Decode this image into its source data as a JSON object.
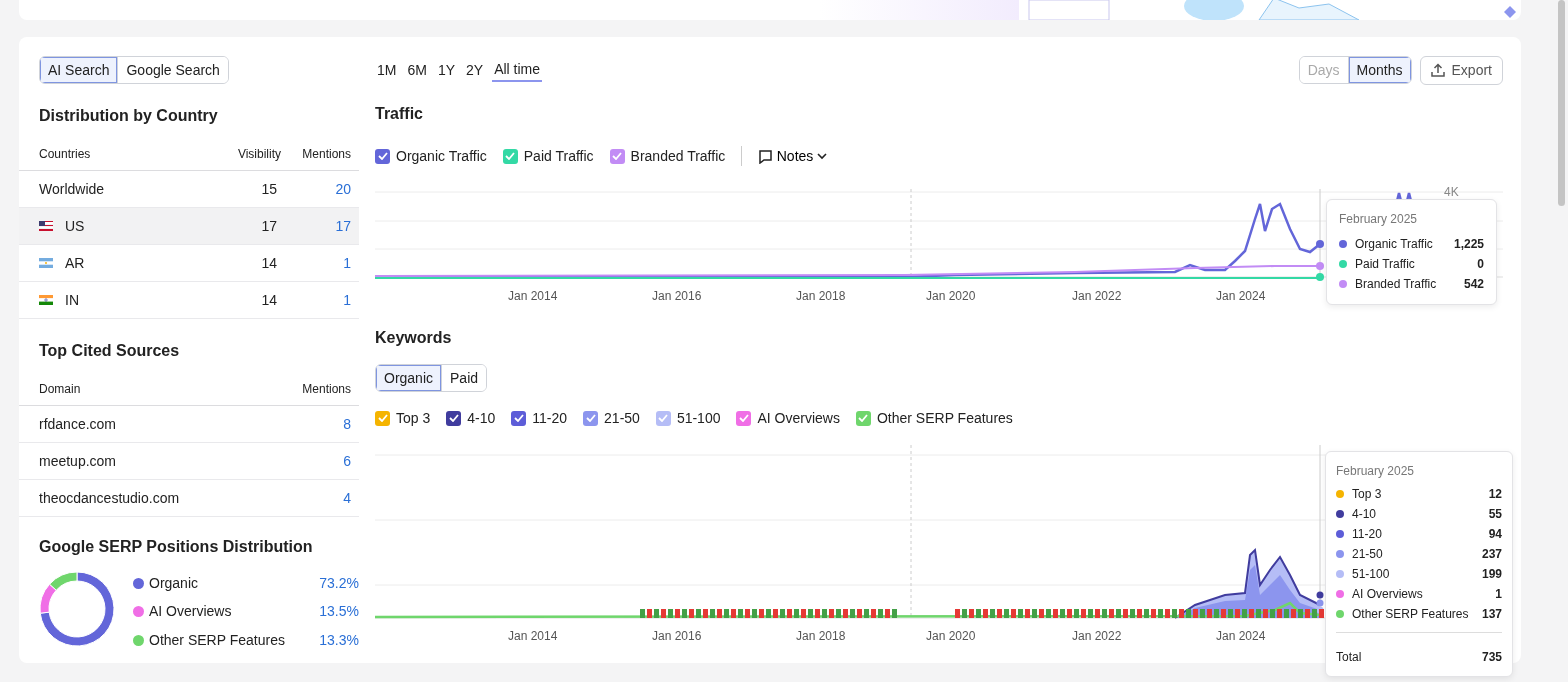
{
  "source_tabs": [
    {
      "label": "AI Search",
      "selected": true
    },
    {
      "label": "Google Search",
      "selected": false
    }
  ],
  "country_table": {
    "title": "Distribution by Country",
    "columns": [
      "Countries",
      "Visibility",
      "Mentions"
    ],
    "rows": [
      {
        "country": "Worldwide",
        "kind": "global",
        "visibility": "15",
        "mentions": "20",
        "selected": false
      },
      {
        "country": "US",
        "kind": "us",
        "visibility": "17",
        "mentions": "17",
        "selected": true
      },
      {
        "country": "AR",
        "kind": "ar",
        "visibility": "14",
        "mentions": "1",
        "selected": false
      },
      {
        "country": "IN",
        "kind": "in",
        "visibility": "14",
        "mentions": "1",
        "selected": false
      }
    ]
  },
  "sources_table": {
    "title": "Top Cited Sources",
    "columns": [
      "Domain",
      "Mentions"
    ],
    "rows": [
      {
        "domain": "rfdance.com",
        "mentions": "8"
      },
      {
        "domain": "meetup.com",
        "mentions": "6"
      },
      {
        "domain": "theocdancestudio.com",
        "mentions": "4"
      }
    ]
  },
  "serp_distribution": {
    "title": "Google SERP Positions Distribution",
    "items": [
      {
        "label": "Organic",
        "value": "73.2%",
        "color": "#6366d9"
      },
      {
        "label": "AI Overviews",
        "value": "13.5%",
        "color": "#f06ee6"
      },
      {
        "label": "Other SERP Features",
        "value": "13.3%",
        "color": "#6fd66c"
      }
    ]
  },
  "time_ranges": [
    {
      "label": "1M",
      "selected": false
    },
    {
      "label": "6M",
      "selected": false
    },
    {
      "label": "1Y",
      "selected": false
    },
    {
      "label": "2Y",
      "selected": false
    },
    {
      "label": "All time",
      "selected": true
    }
  ],
  "granularity": [
    {
      "label": "Days",
      "selected": false,
      "disabled": true
    },
    {
      "label": "Months",
      "selected": true,
      "disabled": false
    }
  ],
  "export_button": "Export",
  "traffic": {
    "title": "Traffic",
    "legend": [
      {
        "label": "Organic Traffic",
        "checked": true,
        "color": "#6366d9"
      },
      {
        "label": "Paid Traffic",
        "checked": true,
        "color": "#33d9a5"
      },
      {
        "label": "Branded Traffic",
        "checked": true,
        "color": "#c28cf5"
      }
    ],
    "notes_button": "Notes",
    "y_label": "4K",
    "x_labels": [
      "Jan 2014",
      "Jan 2016",
      "Jan 2018",
      "Jan 2020",
      "Jan 2022",
      "Jan 2024"
    ],
    "tooltip": {
      "date": "February 2025",
      "rows": [
        {
          "label": "Organic Traffic",
          "value": "1,225",
          "color": "#6366d9"
        },
        {
          "label": "Paid Traffic",
          "value": "0",
          "color": "#33d9a5"
        },
        {
          "label": "Branded Traffic",
          "value": "542",
          "color": "#c28cf5"
        }
      ]
    }
  },
  "keywords": {
    "title": "Keywords",
    "tabs": [
      {
        "label": "Organic",
        "selected": true
      },
      {
        "label": "Paid",
        "selected": false
      }
    ],
    "legend": [
      {
        "label": "Top 3",
        "checked": true,
        "color": "#f5b400"
      },
      {
        "label": "4-10",
        "checked": true,
        "color": "#403c9e"
      },
      {
        "label": "11-20",
        "checked": true,
        "color": "#5d5dd8"
      },
      {
        "label": "21-50",
        "checked": true,
        "color": "#8c95ee"
      },
      {
        "label": "51-100",
        "checked": true,
        "color": "#b5bdf6"
      },
      {
        "label": "AI Overviews",
        "checked": true,
        "color": "#f06ee6"
      },
      {
        "label": "Other SERP Features",
        "checked": true,
        "color": "#6fd66c"
      }
    ],
    "x_labels": [
      "Jan 2014",
      "Jan 2016",
      "Jan 2018",
      "Jan 2020",
      "Jan 2022",
      "Jan 2024"
    ],
    "tooltip": {
      "date": "February 2025",
      "rows": [
        {
          "label": "Top 3",
          "value": "12",
          "color": "#f5b400"
        },
        {
          "label": "4-10",
          "value": "55",
          "color": "#403c9e"
        },
        {
          "label": "11-20",
          "value": "94",
          "color": "#5d5dd8"
        },
        {
          "label": "21-50",
          "value": "237",
          "color": "#8c95ee"
        },
        {
          "label": "51-100",
          "value": "199",
          "color": "#b5bdf6"
        },
        {
          "label": "AI Overviews",
          "value": "1",
          "color": "#f06ee6"
        },
        {
          "label": "Other SERP Features",
          "value": "137",
          "color": "#6fd66c"
        }
      ],
      "total_label": "Total",
      "total_value": "735"
    }
  }
}
